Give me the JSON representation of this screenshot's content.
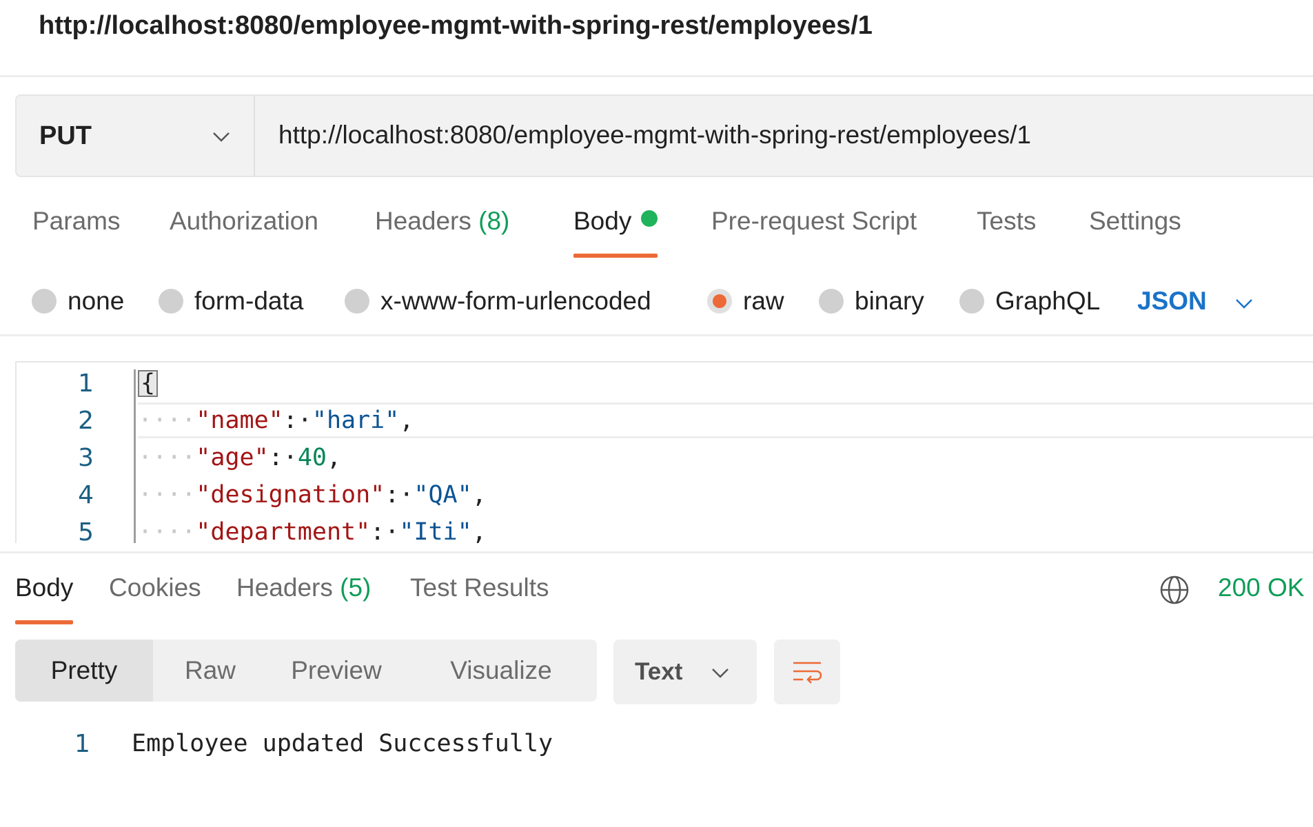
{
  "window": {
    "title": "http://localhost:8080/employee-mgmt-with-spring-rest/employees/1"
  },
  "request": {
    "method": "PUT",
    "url": "http://localhost:8080/employee-mgmt-with-spring-rest/employees/1"
  },
  "request_tabs": [
    {
      "label": "Params"
    },
    {
      "label": "Authorization"
    },
    {
      "label": "Headers",
      "count": "(8)"
    },
    {
      "label": "Body"
    },
    {
      "label": "Pre-request Script"
    },
    {
      "label": "Tests"
    },
    {
      "label": "Settings"
    }
  ],
  "body_types": {
    "options": [
      "none",
      "form-data",
      "x-www-form-urlencoded",
      "raw",
      "binary",
      "GraphQL"
    ],
    "selected": "raw",
    "format": "JSON"
  },
  "editor": {
    "lines": [
      {
        "num": "1",
        "open": "{"
      },
      {
        "num": "2",
        "indent": "····",
        "key": "\"name\"",
        "sep": ":·",
        "value": "\"hari\"",
        "end": ","
      },
      {
        "num": "3",
        "indent": "····",
        "key": "\"age\"",
        "sep": ":·",
        "value": "40",
        "end": ","
      },
      {
        "num": "4",
        "indent": "····",
        "key": "\"designation\"",
        "sep": ":·",
        "value": "\"QA\"",
        "end": ","
      },
      {
        "num": "5",
        "indent": "····",
        "key": "\"department\"",
        "sep": ":·",
        "value": "\"Iti\"",
        "end": ","
      }
    ]
  },
  "response": {
    "tabs": [
      {
        "label": "Body"
      },
      {
        "label": "Cookies"
      },
      {
        "label": "Headers",
        "count": "(5)"
      },
      {
        "label": "Test Results"
      }
    ],
    "status": "200 OK",
    "views": [
      "Pretty",
      "Raw",
      "Preview",
      "Visualize"
    ],
    "format": "Text",
    "body_line_num": "1",
    "body_text": "Employee updated Successfully"
  },
  "colors": {
    "accent": "#ec6a37",
    "status_ok": "#0f9d58",
    "json_link": "#1a73c8",
    "body_dot": "#1fb35b"
  }
}
